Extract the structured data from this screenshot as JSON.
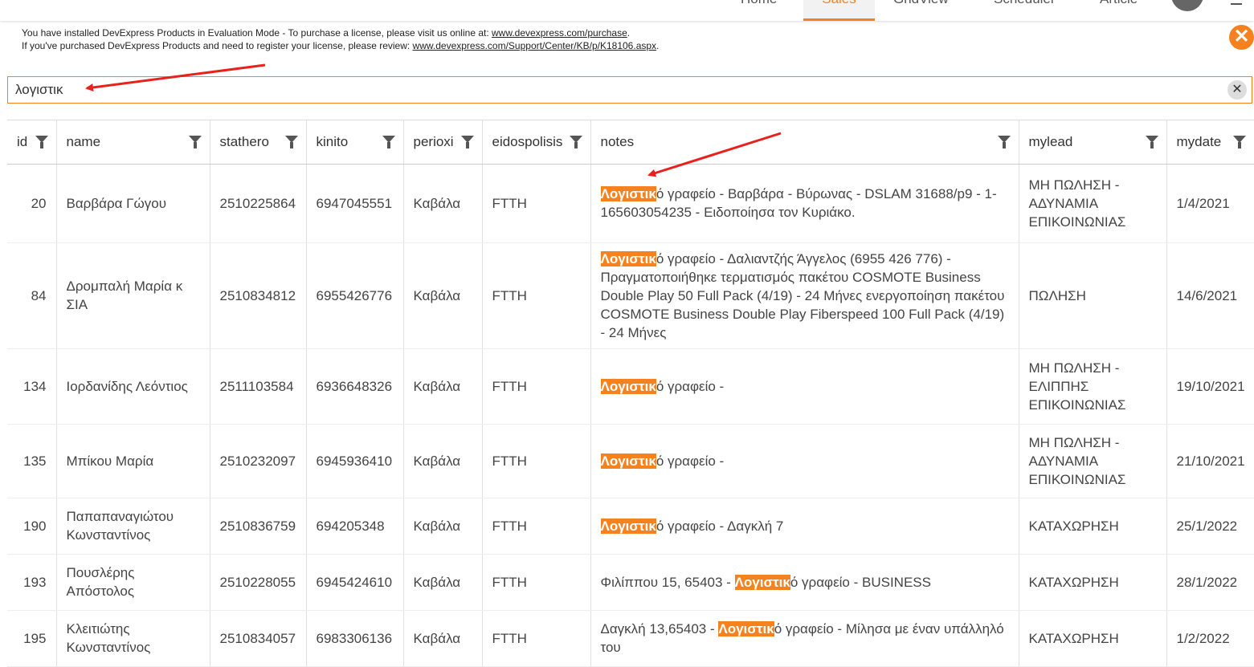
{
  "nav": {
    "items": [
      "Home",
      "Sales",
      "GridView",
      "Scheduler",
      "Article"
    ]
  },
  "banner": {
    "line1_prefix": "You have installed DevExpress Products in Evaluation Mode - To purchase a license, please visit us online at: ",
    "line1_link": "www.devexpress.com/purchase",
    "line1_suffix": ".",
    "line2_prefix": "If you've purchased DevExpress Products and need to register your license, please review: ",
    "line2_link": "www.devexpress.com/Support/Center/KB/p/K18106.aspx",
    "line2_suffix": ".",
    "close_icon": "✕"
  },
  "search": {
    "value": "λογιστικ",
    "clear_icon": "✕"
  },
  "grid": {
    "columns": [
      "id",
      "name",
      "stathero",
      "kinito",
      "perioxi",
      "eidospolisis",
      "notes",
      "mylead",
      "mydate"
    ],
    "rows": [
      {
        "id": "20",
        "name": "Βαρβάρα Γώγου",
        "stathero": "2510225864",
        "kinito": "6947045551",
        "perioxi": "Καβάλα",
        "eidos": "FTTH",
        "notes_pre": "",
        "notes_hl": "Λογιστικ",
        "notes_post": "ό γραφείο - Βαρβάρα - Βύρωνας - DSLAM 31688/p9 - 1-165603054235 - Ειδοποίησα τον Κυριάκο.",
        "mylead": "ΜΗ ΠΩΛΗΣΗ - ΑΔΥΝΑΜΙΑ ΕΠΙΚΟΙΝΩΝΙΑΣ",
        "mydate": "1/4/2021"
      },
      {
        "id": "84",
        "name": "Δρομπαλή Μαρία κ ΣΙΑ",
        "stathero": "2510834812",
        "kinito": "6955426776",
        "perioxi": "Καβάλα",
        "eidos": "FTTH",
        "notes_pre": "",
        "notes_hl": "Λογιστικ",
        "notes_post": "ό γραφείο - Δαλιαντζής Άγγελος (6955 426 776) - Πραγματοποιήθηκε τερματισμός πακέτου COSMOTE Business Double Play 50 Full Pack (4/19) - 24 Μήνες ενεργοποίηση πακέτου COSMOTE Business Double Play Fiberspeed 100 Full Pack (4/19) - 24 Μήνες",
        "mylead": "ΠΩΛΗΣΗ",
        "mydate": "14/6/2021"
      },
      {
        "id": "134",
        "name": "Ιορδανίδης Λεόντιος",
        "stathero": "2511103584",
        "kinito": "6936648326",
        "perioxi": "Καβάλα",
        "eidos": "FTTH",
        "notes_pre": "",
        "notes_hl": "Λογιστικ",
        "notes_post": "ό γραφείο -",
        "mylead": "ΜΗ ΠΩΛΗΣΗ - ΕΛΙΠΠΗΣ ΕΠΙΚΟΙΝΩΝΙΑΣ",
        "mydate": "19/10/2021"
      },
      {
        "id": "135",
        "name": "Μπίκου Μαρία",
        "stathero": "2510232097",
        "kinito": "6945936410",
        "perioxi": "Καβάλα",
        "eidos": "FTTH",
        "notes_pre": "",
        "notes_hl": "Λογιστικ",
        "notes_post": "ό γραφείο -",
        "mylead": "ΜΗ ΠΩΛΗΣΗ - ΑΔΥΝΑΜΙΑ ΕΠΙΚΟΙΝΩΝΙΑΣ",
        "mydate": "21/10/2021"
      },
      {
        "id": "190",
        "name": "Παπαπαναγιώτου Κωνσταντίνος",
        "stathero": "2510836759",
        "kinito": "694205348",
        "perioxi": "Καβάλα",
        "eidos": "FTTH",
        "notes_pre": "",
        "notes_hl": "Λογιστικ",
        "notes_post": "ό γραφείο - Δαγκλή 7",
        "mylead": "ΚΑΤΑΧΩΡΗΣΗ",
        "mydate": "25/1/2022"
      },
      {
        "id": "193",
        "name": "Πουσλέρης Απόστολος",
        "stathero": "2510228055",
        "kinito": "6945424610",
        "perioxi": "Καβάλα",
        "eidos": "FTTH",
        "notes_pre": "Φιλίππου 15, 65403 - ",
        "notes_hl": "Λογιστικ",
        "notes_post": "ό γραφείο - BUSINESS",
        "mylead": "ΚΑΤΑΧΩΡΗΣΗ",
        "mydate": "28/1/2022"
      },
      {
        "id": "195",
        "name": "Κλειτιώτης Κωνσταντίνος",
        "stathero": "2510834057",
        "kinito": "6983306136",
        "perioxi": "Καβάλα",
        "eidos": "FTTH",
        "notes_pre": "Δαγκλή 13,65403 - ",
        "notes_hl": "Λογιστικ",
        "notes_post": "ό γραφείο - Μίλησα με έναν υπάλληλό του",
        "mylead": "ΚΑΤΑΧΩΡΗΣΗ",
        "mydate": "1/2/2022"
      }
    ]
  },
  "colors": {
    "accent": "#f5821f",
    "arrow": "#e8211d"
  }
}
